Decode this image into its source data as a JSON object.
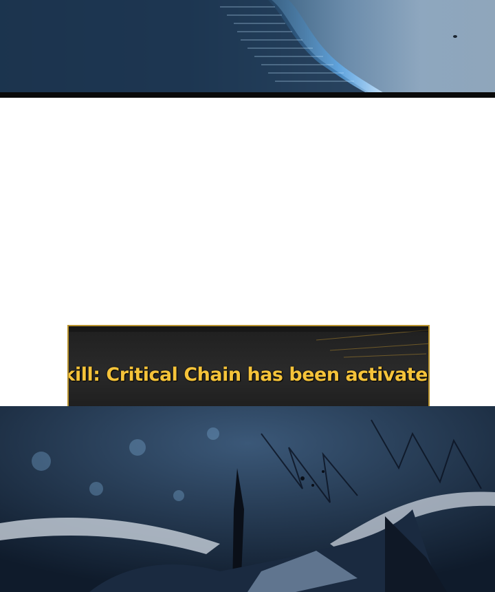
{
  "system_message": {
    "text": "Skill: Critical Chain has been activated."
  },
  "colors": {
    "message_text": "#f5c33a",
    "message_border": "#b8922c",
    "message_background": "#222222",
    "energy_glow": "#5ab4ff"
  }
}
